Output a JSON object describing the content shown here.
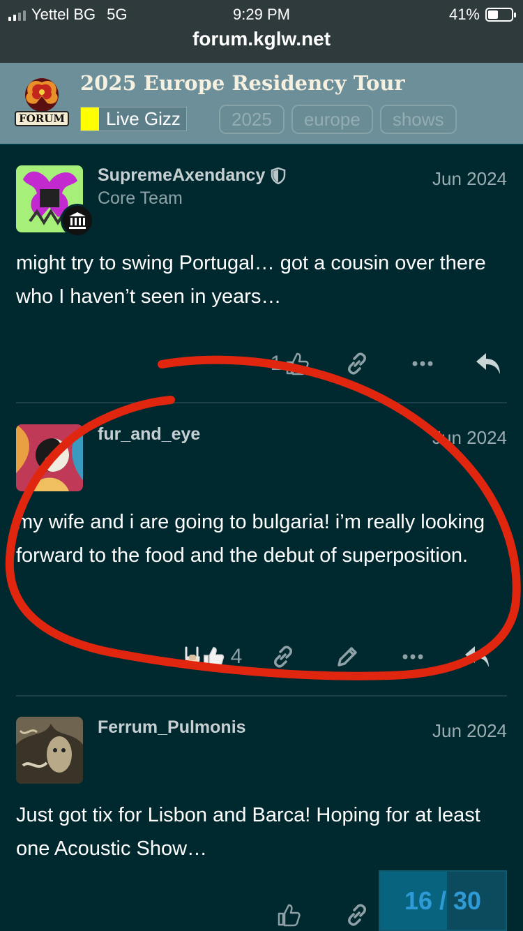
{
  "status_bar": {
    "carrier": "Yettel BG",
    "network": "5G",
    "time": "9:29 PM",
    "battery": "41%"
  },
  "browser": {
    "url": "forum.kglw.net"
  },
  "topic": {
    "logo_text": "FORUM",
    "title": "2025 Europe Residency Tour",
    "category": "Live Gizz",
    "category_color": "#ffff00",
    "tags": [
      "2025",
      "europe",
      "shows"
    ]
  },
  "posts": [
    {
      "username": "SupremeAxendancy",
      "user_title": "Core Team",
      "date": "Jun 2024",
      "body": "might try to swing Portugal… got a cousin over there who I haven’t seen in years…",
      "like_count": "1",
      "icons": [
        "shield-icon",
        "bank-icon",
        "thumbs-up-icon",
        "link-icon",
        "more-icon",
        "reply-icon"
      ]
    },
    {
      "username": "fur_and_eye",
      "date": "Jun 2024",
      "body": "my wife and i are going to bulgaria! i’m really looking forward to the food and the debut of superposition.",
      "like_count": "4",
      "icons": [
        "rock-hand-icon",
        "thumbs-up-icon",
        "link-icon",
        "edit-icon",
        "more-icon",
        "reply-icon"
      ]
    },
    {
      "username": "Ferrum_Pulmonis",
      "date": "Jun 2024",
      "body": "Just got tix for Lisbon and Barca! Hoping for at least one Acoustic Show…",
      "icons": [
        "thumbs-up-icon",
        "link-icon"
      ]
    }
  ],
  "progress": {
    "current": "16",
    "separator": "/",
    "total": "30",
    "fraction": 0.533
  },
  "annotation": {
    "color": "#e0260f"
  }
}
